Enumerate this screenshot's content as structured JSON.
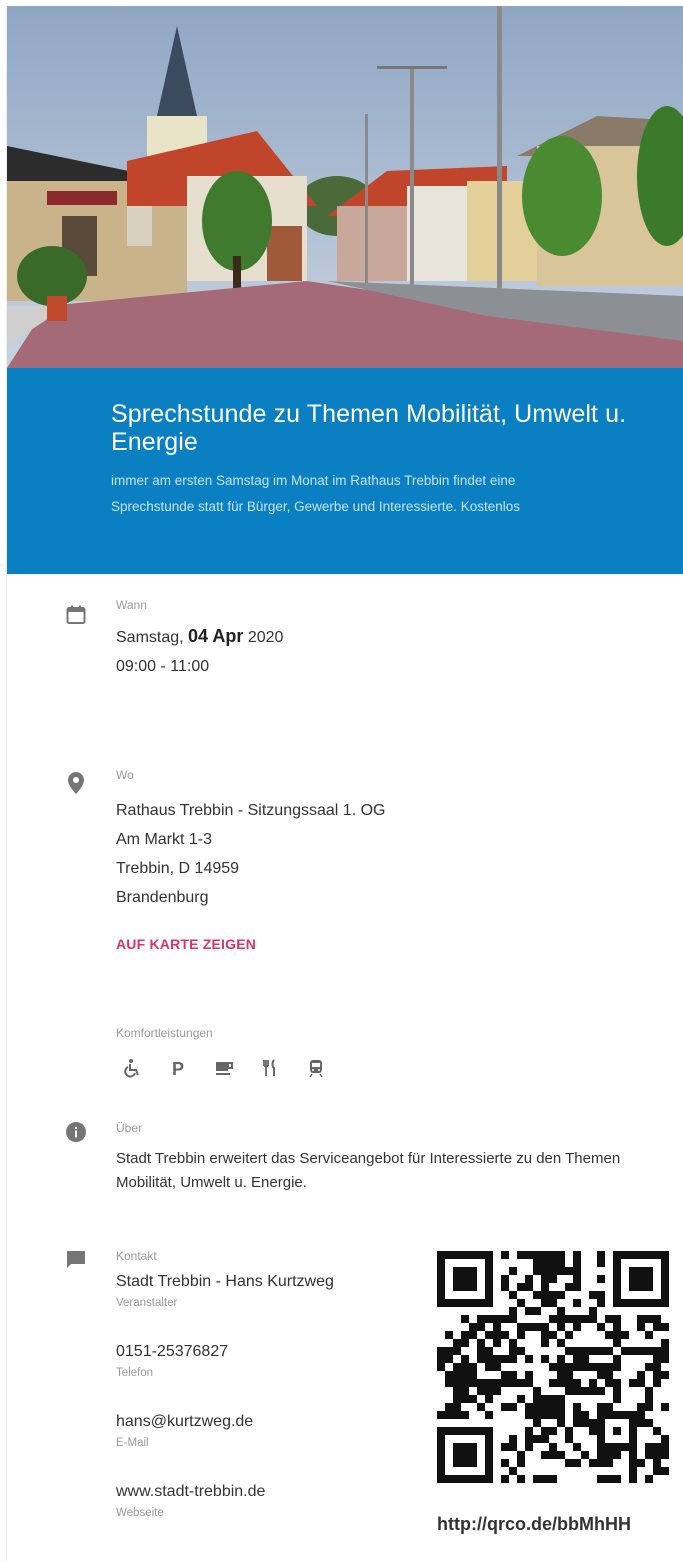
{
  "event": {
    "title": "Sprechstunde zu Themen Mobilität, Umwelt u. Energie",
    "subtitle": "immer am ersten Samstag im Monat im Rathaus Trebbin findet eine Sprechstunde statt für Bürger, Gewerbe und Interessierte. Kostenlos"
  },
  "when": {
    "label": "Wann",
    "weekday": "Samstag,",
    "date_bold": "04 Apr",
    "year": "2020",
    "time": "09:00 - 11:00",
    "icon": "calendar-icon"
  },
  "where": {
    "label": "Wo",
    "lines": [
      "Rathaus Trebbin - Sitzungssaal 1. OG",
      "Am Markt 1-3",
      "Trebbin, D 14959",
      "Brandenburg"
    ],
    "map_link": "AUF KARTE ZEIGEN",
    "icon": "location-pin-icon"
  },
  "amenities": {
    "label": "Komfortleistungen",
    "icons": [
      "wheelchair-icon",
      "parking-icon",
      "coffee-icon",
      "restaurant-icon",
      "train-icon"
    ]
  },
  "about": {
    "label": "Über",
    "text": "Stadt Trebbin erweitert das Serviceangebot für Interessierte zu den Themen Mobilität, Umwelt u. Energie.",
    "icon": "info-icon"
  },
  "contact": {
    "label": "Kontakt",
    "icon": "chat-icon",
    "items": [
      {
        "value": "Stadt Trebbin - Hans Kurtzweg",
        "sub": "Veranstalter"
      },
      {
        "value": "0151-25376827",
        "sub": "Telefon"
      },
      {
        "value": "hans@kurtzweg.de",
        "sub": "E-Mail"
      },
      {
        "value": "www.stadt-trebbin.de",
        "sub": "Webseite"
      }
    ]
  },
  "qr": {
    "url": "http://qrco.de/bbMhHH"
  },
  "colors": {
    "header_bg": "#0a7fc2",
    "link": "#e0306a"
  }
}
